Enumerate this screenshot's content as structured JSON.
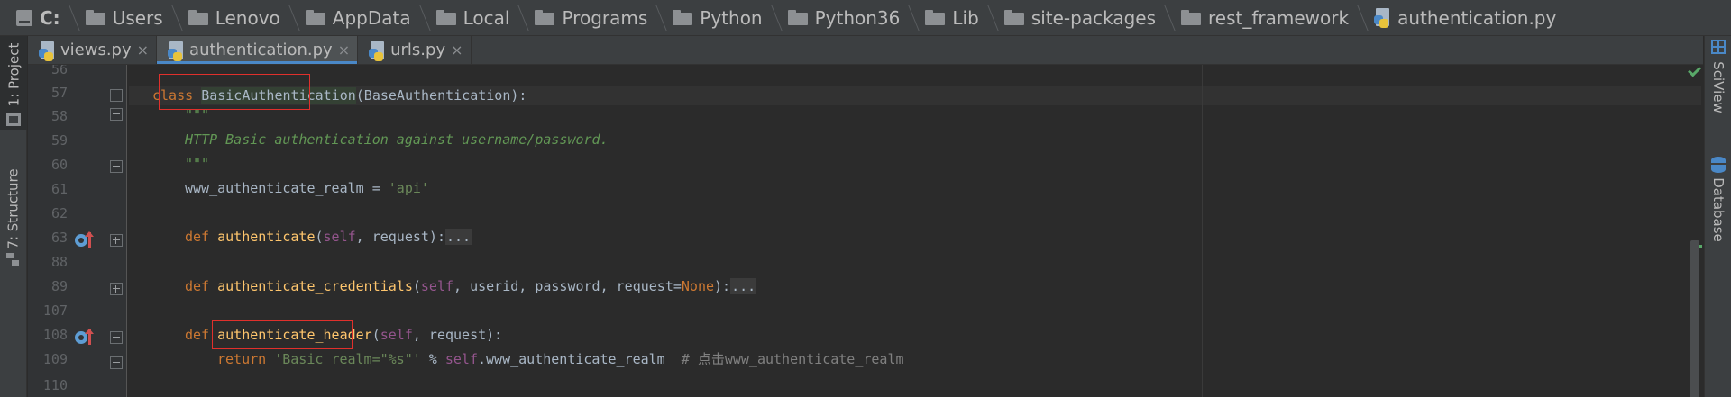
{
  "breadcrumb": {
    "items": [
      {
        "label": "C:",
        "icon": "drive-icon"
      },
      {
        "label": "Users",
        "icon": "folder-icon"
      },
      {
        "label": "Lenovo",
        "icon": "folder-icon"
      },
      {
        "label": "AppData",
        "icon": "folder-icon"
      },
      {
        "label": "Local",
        "icon": "folder-icon"
      },
      {
        "label": "Programs",
        "icon": "folder-icon"
      },
      {
        "label": "Python",
        "icon": "folder-icon"
      },
      {
        "label": "Python36",
        "icon": "folder-icon"
      },
      {
        "label": "Lib",
        "icon": "folder-icon"
      },
      {
        "label": "site-packages",
        "icon": "folder-icon"
      },
      {
        "label": "rest_framework",
        "icon": "folder-icon"
      },
      {
        "label": "authentication.py",
        "icon": "python-file-icon"
      }
    ]
  },
  "tool_windows": {
    "left": [
      {
        "label": "1: Project",
        "active": true
      },
      {
        "label": "7: Structure",
        "active": false
      }
    ],
    "right": [
      {
        "label": "SciView"
      },
      {
        "label": "Database"
      }
    ]
  },
  "editor_tabs": [
    {
      "label": "views.py",
      "close": "×",
      "active": false
    },
    {
      "label": "authentication.py",
      "close": "×",
      "active": true
    },
    {
      "label": "urls.py",
      "close": "×",
      "active": false
    }
  ],
  "gutter": {
    "line_numbers": [
      "56",
      "57",
      "58",
      "59",
      "60",
      "61",
      "62",
      "63",
      "88",
      "89",
      "107",
      "108",
      "109",
      "110"
    ]
  },
  "code": {
    "l57": {
      "kw": "class ",
      "name": "BasicAuthentication",
      "rest": "(BaseAuthentication):"
    },
    "l58": "\"\"\"",
    "l59": "HTTP Basic authentication against username/password.",
    "l60": "\"\"\"",
    "l61": {
      "name": "www_authenticate_realm = ",
      "str": "'api'"
    },
    "l63": {
      "kw": "def ",
      "fn": "authenticate",
      "open": "(",
      "self": "self",
      "rest": ", request):",
      "dots": "..."
    },
    "l89": {
      "kw": "def ",
      "fn": "authenticate_credentials",
      "open": "(",
      "self": "self",
      "mid": ", userid, password, request=",
      "none": "None",
      "close": "):",
      "dots": "..."
    },
    "l108": {
      "kw": "def ",
      "fn": "authenticate_header",
      "open": "(",
      "self": "self",
      "rest": ", request):"
    },
    "l109": {
      "kw": "return ",
      "str": "'Basic realm=\"%s\"'",
      "op": " % ",
      "self": "self",
      "attr": ".www_authenticate_realm",
      "cmt": "  # 点击www_authenticate_realm"
    }
  },
  "colors": {
    "background": "#2b2b2b",
    "keyword": "#cc7832",
    "function": "#ffc66d",
    "string": "#6a8759",
    "docstring": "#629755",
    "self": "#94558d",
    "comment": "#808080",
    "annotation_box": "#e0302c"
  }
}
